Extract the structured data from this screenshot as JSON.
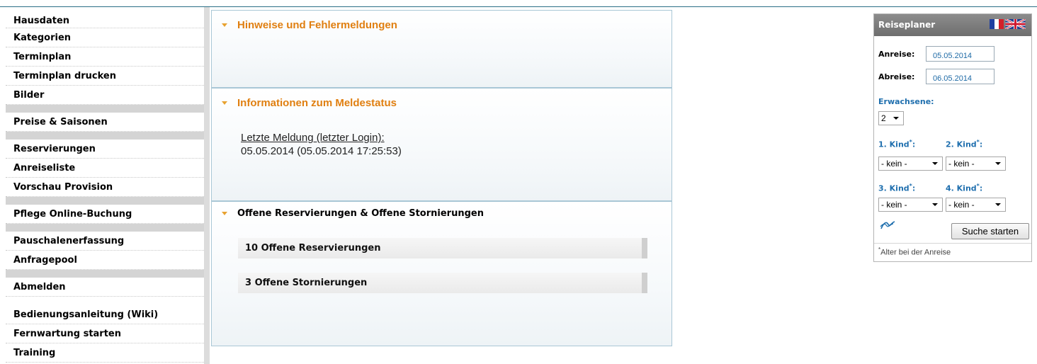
{
  "nav": {
    "items": [
      {
        "label": "Hausdaten"
      },
      {
        "label": "Kategorien"
      },
      {
        "label": "Terminplan"
      },
      {
        "label": "Terminplan drucken"
      },
      {
        "label": "Bilder"
      },
      {
        "label": "Preise & Saisonen"
      },
      {
        "label": "Reservierungen"
      },
      {
        "label": "Anreiseliste"
      },
      {
        "label": "Vorschau Provision"
      },
      {
        "label": "Pflege Online-Buchung"
      },
      {
        "label": "Pauschalenerfassung"
      },
      {
        "label": "Anfragepool"
      },
      {
        "label": "Abmelden"
      },
      {
        "label": "Bedienungsanleitung (Wiki)"
      },
      {
        "label": "Fernwartung starten"
      },
      {
        "label": "Training"
      }
    ]
  },
  "panels": {
    "hinweise": {
      "title": "Hinweise und Fehlermeldungen"
    },
    "meldestatus": {
      "title": "Informationen zum Meldestatus",
      "label": "Letzte Meldung (letzter Login):",
      "value": "05.05.2014 (05.05.2014 17:25:53)"
    },
    "offene": {
      "title": "Offene Reservierungen & Offene Stornierungen",
      "reservierungen": "10 Offene Reservierungen",
      "stornierungen": "3 Offene Stornierungen"
    }
  },
  "planer": {
    "title": "Reiseplaner",
    "anreise_label": "Anreise:",
    "anreise_value": "05.05.2014",
    "abreise_label": "Abreise:",
    "abreise_value": "06.05.2014",
    "erwachsene_label": "Erwachsene:",
    "erwachsene_value": "2",
    "kind1_label": "1. Kind",
    "kind2_label": "2. Kind",
    "kind3_label": "3. Kind",
    "kind4_label": "4. Kind",
    "asterisk": "*",
    "colon": ":",
    "kind_value": "- kein -",
    "search_button": "Suche starten",
    "footnote_mark": "*",
    "footnote": "Alter bei der Anreise",
    "colors": {
      "header": "#7d7d7d",
      "accent": "#1f6fae",
      "title_orange": "#e07f10"
    }
  }
}
